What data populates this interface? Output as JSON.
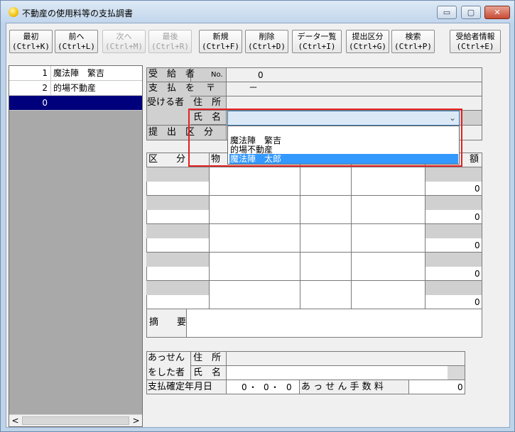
{
  "window": {
    "title": "不動産の使用料等の支払調書",
    "buttons": {
      "minimize": "▭",
      "maximize": "▢",
      "close": "✕"
    }
  },
  "toolbar": {
    "first": {
      "label": "最初",
      "shortcut": "(Ctrl+K)"
    },
    "prev": {
      "label": "前へ",
      "shortcut": "(Ctrl+L)"
    },
    "next": {
      "label": "次へ",
      "shortcut": "(Ctrl+M)"
    },
    "last": {
      "label": "最後",
      "shortcut": "(Ctrl+R)"
    },
    "new": {
      "label": "新規",
      "shortcut": "(Ctrl+F)"
    },
    "delete": {
      "label": "削除",
      "shortcut": "(Ctrl+D)"
    },
    "data_list": {
      "label": "データ一覧",
      "shortcut": "(Ctrl+I)"
    },
    "submit_category": {
      "label": "提出区分",
      "shortcut": "(Ctrl+G)"
    },
    "search": {
      "label": "検索",
      "shortcut": "(Ctrl+P)"
    },
    "recipient_info": {
      "label": "受給者情報",
      "shortcut": "(Ctrl+E)"
    }
  },
  "left_list": {
    "rows": [
      {
        "num": "1",
        "name": "魔法陣　繁吉"
      },
      {
        "num": "2",
        "name": "的場不動産"
      },
      {
        "num": "0",
        "name": ""
      }
    ],
    "scroll_left": "<",
    "scroll_right": ">"
  },
  "recipient": {
    "label_1": "受　給　者",
    "no_label": "No.",
    "no_value": "0",
    "label_2": "支　払　を",
    "postal_mark": "〒",
    "postal_value": "－",
    "label_3": "受ける者",
    "address_label": "住　所",
    "name_label": "氏　名",
    "submit_label": "提　出　区　分"
  },
  "name_dropdown": {
    "options": [
      "魔法陣　繁吉",
      "的場不動産",
      "魔法陣　太郎"
    ],
    "selected_index": 2
  },
  "detail_table": {
    "col_category": "区　　分",
    "col_property": "物",
    "col_amount": "額",
    "row_amounts": [
      "0",
      "0",
      "0",
      "0",
      "0"
    ]
  },
  "summary": {
    "label": "摘　　要"
  },
  "agent": {
    "label_1": "あっせん",
    "label_2": "をした者",
    "address_label": "住　所",
    "name_label": "氏　名",
    "date_label": "支払確定年月日",
    "date_year": "0",
    "date_month": "0",
    "date_day": "0",
    "date_sep": "・",
    "fee_label": "あ っ せ ん 手 数 料",
    "fee_value": "0"
  }
}
